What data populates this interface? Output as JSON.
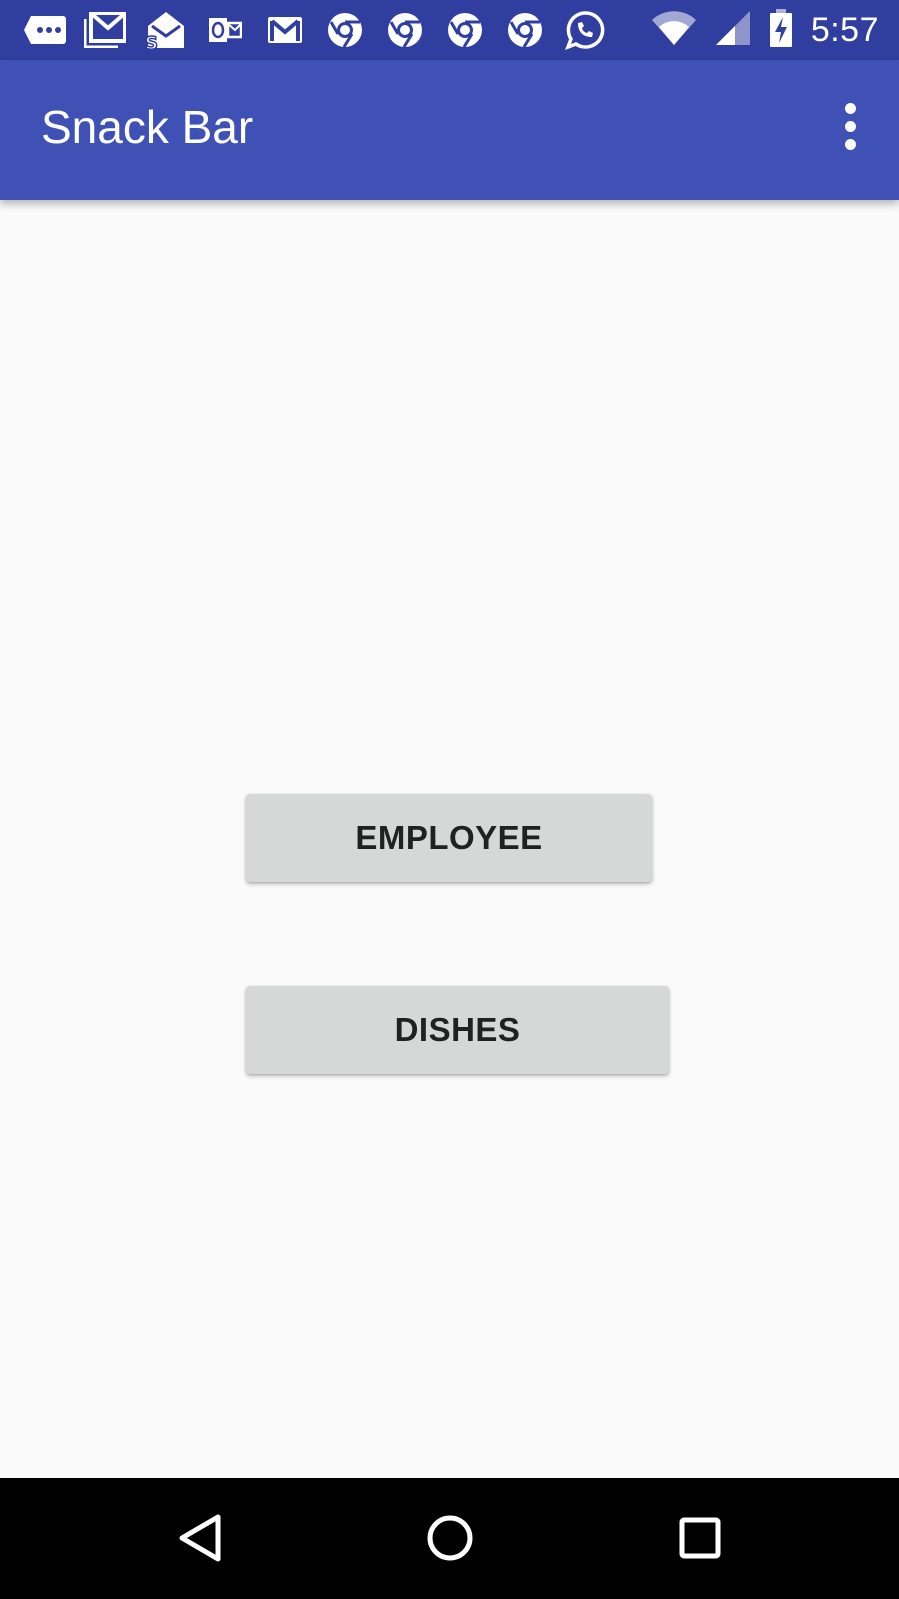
{
  "status_bar": {
    "time": "5:57",
    "notification_icons": [
      "chat-bubble-icon",
      "gmail-icon",
      "mail-s-icon",
      "outlook-icon",
      "gmail-icon",
      "chrome-icon",
      "chrome-icon",
      "chrome-icon",
      "chrome-icon",
      "whatsapp-icon"
    ],
    "system_icons": [
      "wifi-icon",
      "cellular-signal-icon",
      "battery-charging-icon"
    ],
    "background_color": "#303F9F"
  },
  "app_bar": {
    "title": "Snack Bar",
    "overflow_icon": "more-vert-icon",
    "background_color": "#3F51B5"
  },
  "main": {
    "buttons": [
      {
        "label": "EMPLOYEE"
      },
      {
        "label": "DISHES"
      }
    ]
  },
  "nav_bar": {
    "buttons": [
      "back-icon",
      "home-icon",
      "recent-apps-icon"
    ]
  }
}
